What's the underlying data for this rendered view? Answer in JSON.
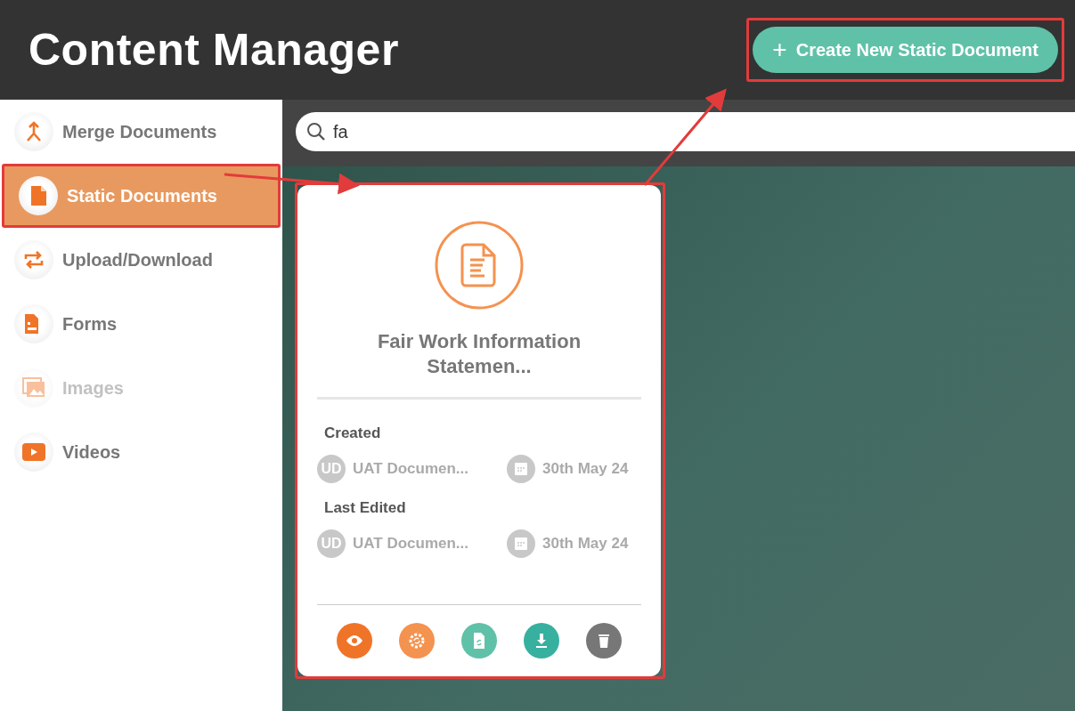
{
  "header": {
    "title": "Content Manager",
    "create_button": {
      "label": "Create New Static Document",
      "icon": "+",
      "highlighted": true
    }
  },
  "sidebar": {
    "items": [
      {
        "label": "Merge Documents",
        "selected": false,
        "disabled": false,
        "highlighted": false
      },
      {
        "label": "Static Documents",
        "selected": true,
        "disabled": false,
        "highlighted": true
      },
      {
        "label": "Upload/Download",
        "selected": false,
        "disabled": false,
        "highlighted": false
      },
      {
        "label": "Forms",
        "selected": false,
        "disabled": false,
        "highlighted": false
      },
      {
        "label": "Images",
        "selected": false,
        "disabled": true,
        "highlighted": false
      },
      {
        "label": "Videos",
        "selected": false,
        "disabled": false,
        "highlighted": false
      }
    ]
  },
  "search": {
    "value": "fa"
  },
  "cards": [
    {
      "title": "Fair Work Information Statemen...",
      "highlighted": true,
      "meta": [
        {
          "label": "Created",
          "initials": "UD",
          "user": "UAT Documen...",
          "date": "30th May 24"
        },
        {
          "label": "Last Edited",
          "initials": "UD",
          "user": "UAT Documen...",
          "date": "30th May 24"
        }
      ],
      "actions": [
        {
          "kind": "view",
          "color": "#f07428"
        },
        {
          "kind": "settings",
          "color": "#f4924f"
        },
        {
          "kind": "regenerate",
          "color": "#5fc1a8"
        },
        {
          "kind": "download",
          "color": "#38b0a0"
        },
        {
          "kind": "delete",
          "color": "#777777"
        }
      ]
    }
  ]
}
